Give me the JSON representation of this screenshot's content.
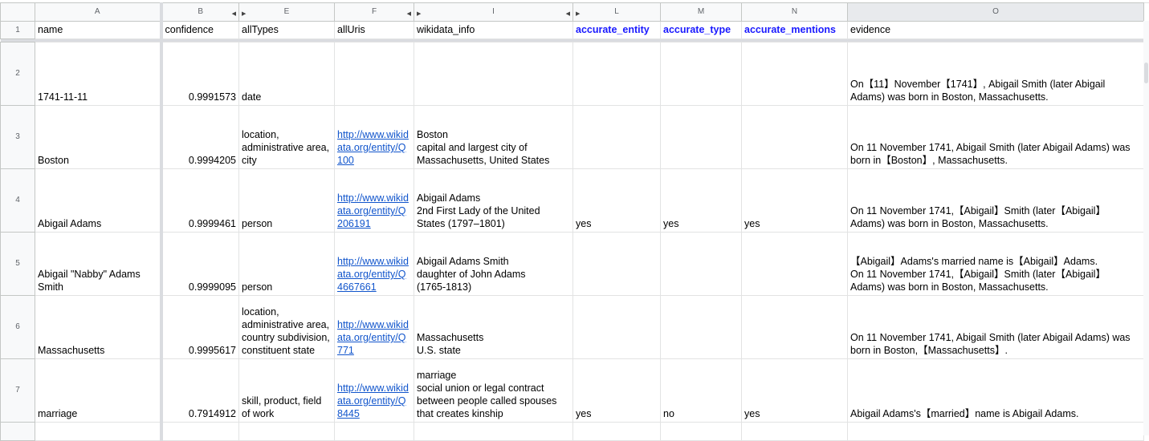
{
  "columns": [
    "A",
    "B",
    "E",
    "F",
    "I",
    "L",
    "M",
    "N",
    "O"
  ],
  "headers": [
    "name",
    "confidence",
    "allTypes",
    "allUris",
    "wikidata_info",
    "accurate_entity",
    "accurate_type",
    "accurate_mentions",
    "evidence"
  ],
  "row_numbers": [
    "1",
    "2",
    "3",
    "4",
    "5",
    "6",
    "7"
  ],
  "rows": [
    {
      "name": "1741-11-11",
      "confidence": "0.9991573",
      "allTypes": "date",
      "allUris": "",
      "wikidata_info": "",
      "accurate_entity": "",
      "accurate_type": "",
      "accurate_mentions": "",
      "evidence": "On【11】November【1741】, Abigail Smith (later Abigail Adams) was born in Boston, Massachusetts."
    },
    {
      "name": "Boston",
      "confidence": "0.9994205",
      "allTypes": "location, administrative area, city",
      "allUris": "http://www.wikidata.org/entity/Q100",
      "wikidata_info": "Boston\ncapital and largest city of Massachusetts, United States",
      "accurate_entity": "",
      "accurate_type": "",
      "accurate_mentions": "",
      "evidence": "On 11 November 1741, Abigail Smith (later Abigail Adams) was born in【Boston】, Massachusetts."
    },
    {
      "name": "Abigail Adams",
      "confidence": "0.9999461",
      "allTypes": "person",
      "allUris": "http://www.wikidata.org/entity/Q206191",
      "wikidata_info": "Abigail Adams\n2nd First Lady of the United States (1797–1801)",
      "accurate_entity": "yes",
      "accurate_type": "yes",
      "accurate_mentions": "yes",
      "evidence": "On 11 November 1741,【Abigail】Smith (later【Abigail】 Adams) was born in Boston, Massachusetts."
    },
    {
      "name": "Abigail \"Nabby\" Adams Smith",
      "confidence": "0.9999095",
      "allTypes": "person",
      "allUris": "http://www.wikidata.org/entity/Q4667661",
      "wikidata_info": "Abigail Adams Smith\ndaughter of John Adams\n(1765-1813)",
      "accurate_entity": "",
      "accurate_type": "",
      "accurate_mentions": "",
      "evidence": "【Abigail】Adams's married name is【Abigail】Adams.\nOn 11 November 1741,【Abigail】Smith (later【Abigail】 Adams) was born in Boston, Massachusetts."
    },
    {
      "name": "Massachusetts",
      "confidence": "0.9995617",
      "allTypes": "location, administrative area, country subdivision, constituent state",
      "allUris": "http://www.wikidata.org/entity/Q771",
      "wikidata_info": "Massachusetts\nU.S. state",
      "accurate_entity": "",
      "accurate_type": "",
      "accurate_mentions": "",
      "evidence": "On 11 November 1741, Abigail Smith (later Abigail Adams) was born in Boston,【Massachusetts】."
    },
    {
      "name": "marriage",
      "confidence": "0.7914912",
      "allTypes": "skill, product, field of work",
      "allUris": "http://www.wikidata.org/entity/Q8445",
      "wikidata_info": "marriage\nsocial union or legal contract between people called spouses that creates kinship",
      "accurate_entity": "yes",
      "accurate_type": "no",
      "accurate_mentions": "yes",
      "evidence": "Abigail Adams's【married】name is Abigail Adams."
    }
  ],
  "colors": {
    "header_highlight": "#1a1aff",
    "link": "#1155cc",
    "gridline": "#e2e3e3"
  }
}
